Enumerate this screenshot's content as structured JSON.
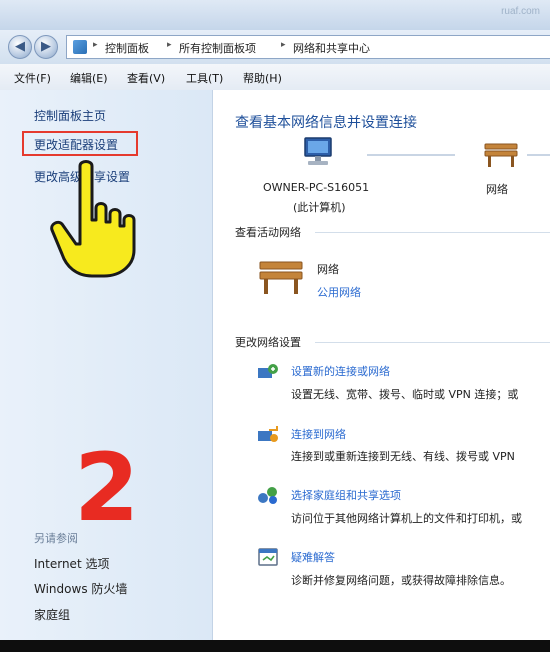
{
  "titlebar": {
    "faint_text": "ruaf.com"
  },
  "address": {
    "breadcrumbs": [
      "控制面板",
      "所有控制面板项",
      "网络和共享中心"
    ],
    "separator": "▸"
  },
  "menu": [
    "文件(F)",
    "编辑(E)",
    "查看(V)",
    "工具(T)",
    "帮助(H)"
  ],
  "left": {
    "home": "控制面板主页",
    "adapter_settings": "更改适配器设置",
    "sharing_settings": "更改高级共享设置",
    "see_also_title": "另请参阅",
    "see_also": [
      "Internet 选项",
      "Windows 防火墙",
      "家庭组"
    ],
    "step_number": "2"
  },
  "main": {
    "title": "查看基本网络信息并设置连接",
    "computer_name": "OWNER-PC-S16051",
    "computer_sub": "(此计算机)",
    "network_label": "网络",
    "active_title": "查看活动网络",
    "active_name": "网络",
    "active_type": "公用网络",
    "change_title": "更改网络设置",
    "tasks": [
      {
        "link": "设置新的连接或网络",
        "desc": "设置无线、宽带、拨号、临时或 VPN 连接；或"
      },
      {
        "link": "连接到网络",
        "desc": "连接到或重新连接到无线、有线、拨号或 VPN"
      },
      {
        "link": "选择家庭组和共享选项",
        "desc": "访问位于其他网络计算机上的文件和打印机，或"
      },
      {
        "link": "疑难解答",
        "desc": "诊断并修复网络问题，或获得故障排除信息。"
      }
    ]
  },
  "colors": {
    "highlight_box": "#e53a2e",
    "step_number": "#e82b22",
    "link": "#2a6ad0",
    "pointer": "#f7ea1e"
  }
}
